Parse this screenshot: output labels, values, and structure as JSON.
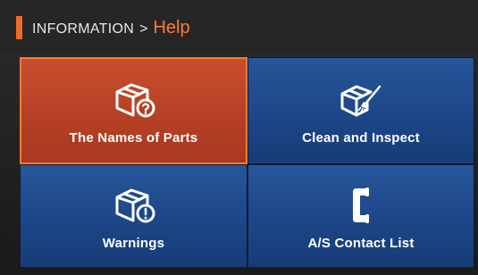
{
  "header": {
    "section": "INFORMATION",
    "separator": ">",
    "current": "Help"
  },
  "tiles": [
    {
      "label": "The Names of Parts",
      "icon": "box-question-icon",
      "selected": true
    },
    {
      "label": "Clean and Inspect",
      "icon": "box-brush-icon",
      "selected": false
    },
    {
      "label": "Warnings",
      "icon": "box-warning-icon",
      "selected": false
    },
    {
      "label": "A/S Contact List",
      "icon": "phone-icon",
      "selected": false
    }
  ],
  "colors": {
    "accent": "#f26a2c",
    "selected_tile": "#b43f24",
    "tile": "#1d4688"
  }
}
